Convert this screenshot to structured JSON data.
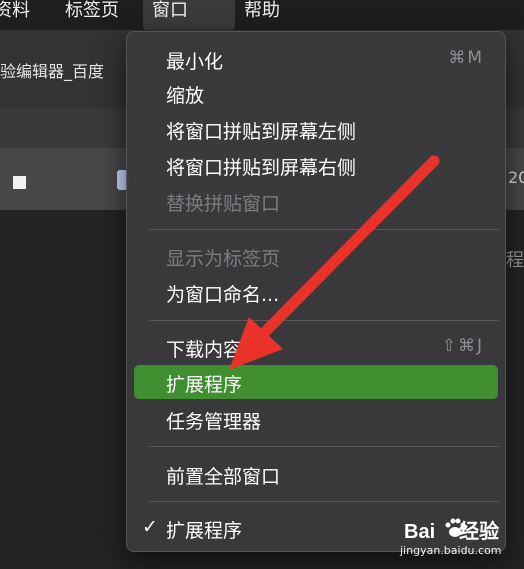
{
  "menubar": {
    "items": [
      {
        "label": "资料"
      },
      {
        "label": "标签页"
      },
      {
        "label": "窗口"
      },
      {
        "label": "帮助"
      }
    ]
  },
  "browser": {
    "tab_title": "验编辑器_百度",
    "right_peek_1": "20",
    "right_peek_2": "程"
  },
  "window_menu": {
    "items": [
      {
        "label": "最小化",
        "shortcut": "⌘M"
      },
      {
        "label": "缩放"
      },
      {
        "label": "将窗口拼贴到屏幕左侧"
      },
      {
        "label": "将窗口拼贴到屏幕右侧"
      },
      {
        "label": "替换拼贴窗口"
      },
      {
        "label": "显示为标签页"
      },
      {
        "label": "为窗口命名..."
      },
      {
        "label": "下载内容",
        "shortcut": "⇧⌘J"
      },
      {
        "label": "扩展程序"
      },
      {
        "label": "任务管理器"
      },
      {
        "label": "前置全部窗口"
      },
      {
        "label": "扩展程序",
        "check": "✓"
      }
    ]
  },
  "watermark": {
    "main_left": "Bai",
    "main_right": "经验",
    "sub": "jingyan.baidu.com"
  },
  "colors": {
    "highlight": "#3f8e2f",
    "arrow": "#e8322a"
  }
}
